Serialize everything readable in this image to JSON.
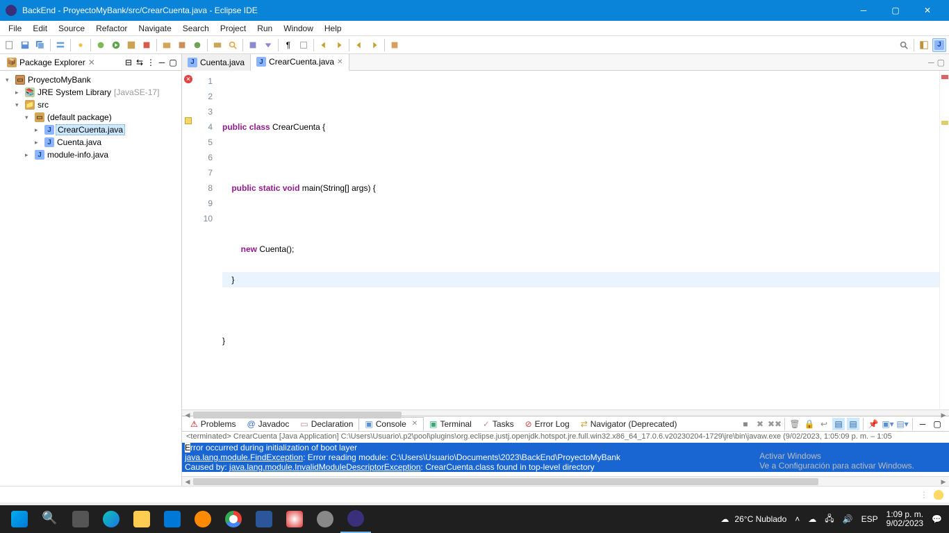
{
  "titlebar": {
    "text": "BackEnd - ProyectoMyBank/src/CrearCuenta.java - Eclipse IDE"
  },
  "menus": [
    "File",
    "Edit",
    "Source",
    "Refactor",
    "Navigate",
    "Search",
    "Project",
    "Run",
    "Window",
    "Help"
  ],
  "sidebar": {
    "title": "Package Explorer",
    "tree": {
      "project": "ProyectoMyBank",
      "jre": "JRE System Library",
      "jre_qual": "[JavaSE-17]",
      "src": "src",
      "default_pkg": "(default package)",
      "file1": "CrearCuenta.java",
      "file2": "Cuenta.java",
      "module": "module-info.java"
    }
  },
  "editor_tabs": {
    "t1": "Cuenta.java",
    "t2": "CrearCuenta.java"
  },
  "code": {
    "l1": "",
    "l2a": "public",
    "l2b": "class",
    "l2c": " CrearCuenta {",
    "l3": "",
    "l4a": "public",
    "l4b": "static",
    "l4c": "void",
    "l4d": " main(String[] args) {",
    "l5": "",
    "l6a": "new",
    "l6b": " Cuenta();",
    "l7": "    }",
    "l8": "",
    "l9": "}",
    "l10": ""
  },
  "line_numbers": [
    "1",
    "2",
    "3",
    "4",
    "5",
    "6",
    "7",
    "8",
    "9",
    "10"
  ],
  "views": {
    "problems": "Problems",
    "javadoc": "Javadoc",
    "declaration": "Declaration",
    "console": "Console",
    "terminal": "Terminal",
    "tasks": "Tasks",
    "errorlog": "Error Log",
    "navigator": "Navigator (Deprecated)"
  },
  "console": {
    "header": "<terminated> CrearCuenta [Java Application] C:\\Users\\Usuario\\.p2\\pool\\plugins\\org.eclipse.justj.openjdk.hotspot.jre.full.win32.x86_64_17.0.6.v20230204-1729\\jre\\bin\\javaw.exe (9/02/2023, 1:05:09 p. m. – 1:05",
    "l1": "Error occurred during initialization of boot layer",
    "l2a": "java.lang.module.FindException",
    "l2b": ": Error reading module: C:\\Users\\Usuario\\Documents\\2023\\BackEnd\\ProyectoMyBank",
    "l3a": "Caused by: ",
    "l3b": "java.lang.module.InvalidModuleDescriptorException",
    "l3c": ": CrearCuenta.class found in top-level directory"
  },
  "watermark": {
    "title": "Activar Windows",
    "sub": "Ve a Configuración para activar Windows."
  },
  "taskbar": {
    "weather": "26°C  Nublado",
    "lang": "ESP",
    "time": "1:09 p. m.",
    "date": "9/02/2023"
  }
}
